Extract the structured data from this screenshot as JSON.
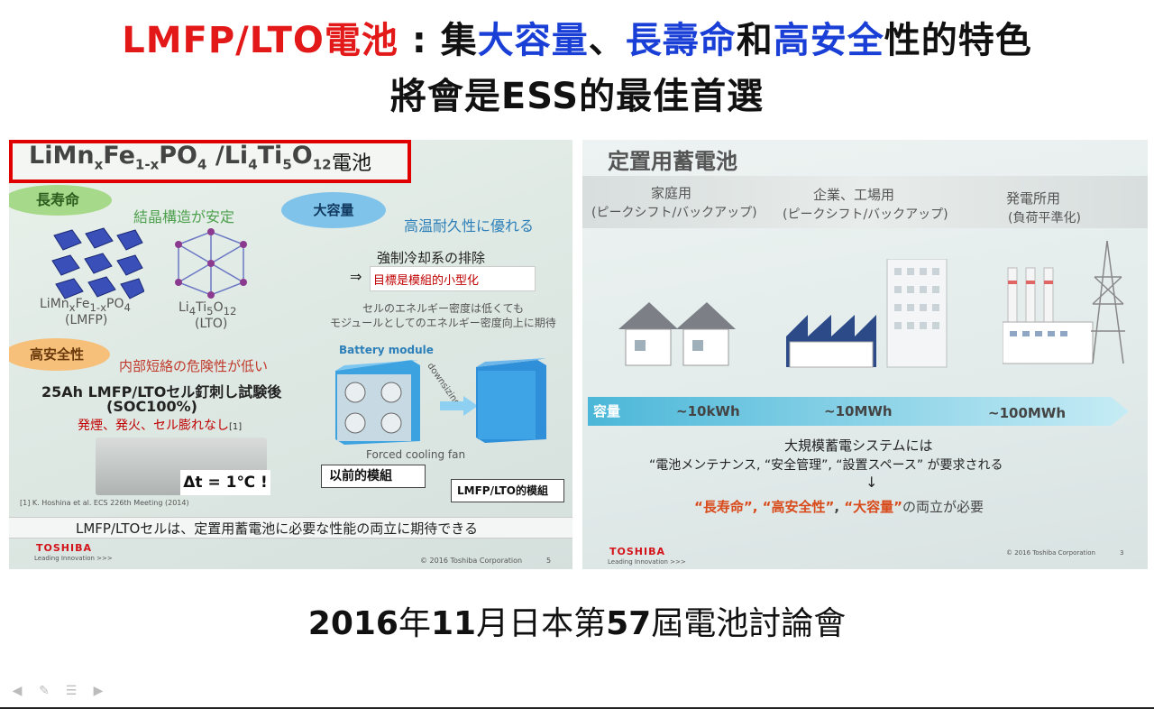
{
  "slide": {
    "title_line1": {
      "red": "LMFP/LTO電池",
      "colon": " : 集",
      "blue1": "大容量",
      "sep1": "、",
      "blue2": "長壽命",
      "mid": "和",
      "blue3": "高安全",
      "end": "性的特色"
    },
    "title_line2": "將會是ESS的最佳首選",
    "caption": {
      "year": "2016",
      "year_suffix": "年",
      "month": "11",
      "month_suffix": "月日本第",
      "number": "57",
      "rest": "屆電池討論會"
    }
  },
  "left_photo": {
    "formula": {
      "p1": "LiMn",
      "s1": "x",
      "p2": "Fe",
      "s2": "1-x",
      "p3": "PO",
      "s3": "4",
      "p4": " /Li",
      "s4": "4",
      "p5": "Ti",
      "s5": "5",
      "p6": "O",
      "s6": "12"
    },
    "formula_suffix": "電池",
    "badge_long_life": "長寿命",
    "badge_capacity": "大容量",
    "badge_safety": "高安全性",
    "text_crystal": "結晶構造が安定",
    "text_heat": "高温耐久性に優れる",
    "crystal1": {
      "line1": "LiMn",
      "sub1": "x",
      "line1b": "Fe",
      "sub2": "1-x",
      "line1c": "PO",
      "sub3": "4",
      "line2": "(LMFP)"
    },
    "crystal2": {
      "line1": "Li",
      "sub1": "4",
      "line1b": "Ti",
      "sub2": "5",
      "line1c": "O",
      "sub3": "12",
      "line2": "(LTO)"
    },
    "text_cooling": "強制冷却系の排除",
    "arrow": "⇒",
    "text_target": "目標是模組的小型化",
    "text_density1": "セルのエネルギー密度は低くても",
    "text_density2": "モジュールとしてのエネルギー密度向上に期待",
    "text_battery_module": "Battery module",
    "text_downsizing": "downsizing",
    "text_forced_cooling": "Forced cooling fan",
    "label_old_module": "以前的模組",
    "label_new_module": "LMFP/LTO的模組",
    "text_short_circuit": "内部短絡の危険性が低い",
    "text_nail_test1": "25Ah LMFP/LTOセル釘刺し試験後",
    "text_nail_test2": "(SOC100%)",
    "text_nail_test3": "発煙、発火、セル膨れなし",
    "text_ref_mark": "[1]",
    "text_delta": "Δt = 1℃ !",
    "text_reference": "[1] K. Hoshina et al. ECS 226th Meeting (2014)",
    "text_bottom": "LMFP/LTOセルは、定置用蓄電池に必要な性能の両立に期待できる",
    "brand": "TOSHIBA",
    "brand_sub": "Leading Innovation >>>",
    "copyright": "© 2016 Toshiba Corporation",
    "page_number": "5"
  },
  "right_photo": {
    "title": "定置用蓄電池",
    "col1": {
      "line1": "家庭用",
      "line2": "(ピークシフト/バックアップ)"
    },
    "col2": {
      "line1": "企業、工場用",
      "line2": "(ピークシフト/バックアップ)"
    },
    "col3": {
      "line1": "発電所用",
      "line2": "(負荷平準化)"
    },
    "capacity_label": "容量",
    "cap1": "~10kWh",
    "cap2": "~10MWh",
    "cap3": "~100MWh",
    "line1": "大規模蓄電システムには",
    "line2": "“電池メンテナンス, “安全管理”, “設置スペース” が要求される",
    "down_arrow": "↓",
    "line3a": "“長寿命”, ",
    "line3b": "“高安全性”",
    "line3c": ", ",
    "line3d": "“大容量”",
    "line3e": "の両立が必要",
    "brand": "TOSHIBA",
    "brand_sub": "Leading Innovation >>>",
    "copyright": "© 2016 Toshiba Corporation",
    "page_number": "3"
  },
  "colors": {
    "title_red": "#e31818",
    "title_blue": "#1a3fd6",
    "highlight_box": "#e00000"
  },
  "toolbar": {
    "back_icon": "back-arrow-icon",
    "pen_icon": "pen-icon",
    "menu_icon": "menu-icon",
    "forward_icon": "forward-arrow-icon"
  }
}
